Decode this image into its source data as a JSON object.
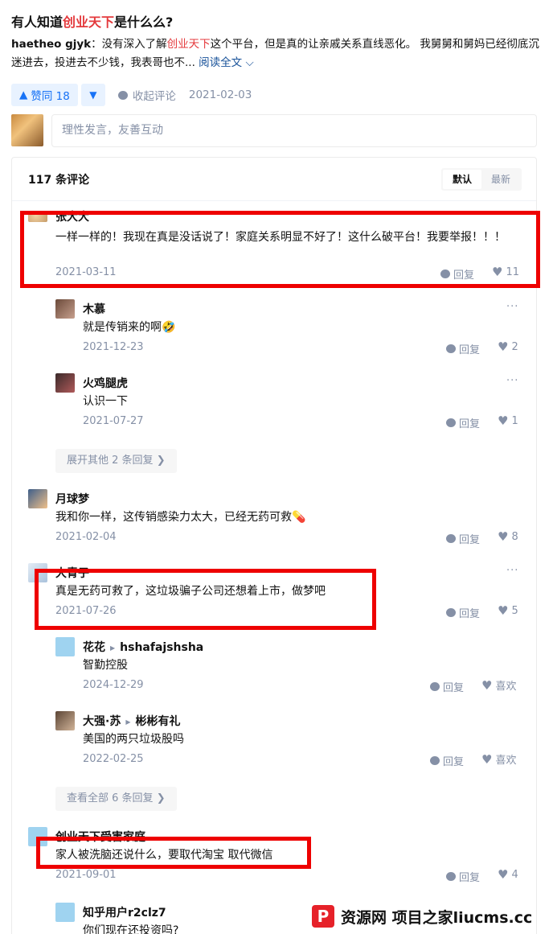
{
  "question": {
    "title_pre": "有人知道",
    "title_hl": "创业天下",
    "title_post": "是什么么?"
  },
  "answer": {
    "author": "haetheo gjyk",
    "sep": "：",
    "text_pre": "没有深入了解",
    "text_hl": "创业天下",
    "text_post": "这个平台，但是真的让亲戚关系直线恶化。 我舅舅和舅妈已经彻底沉迷进去，投进去不少钱，我表哥也不...",
    "read_more": "阅读全文",
    "read_more_icon": "chevron-down-icon"
  },
  "actions": {
    "upvote_label": "赞同 18",
    "upvote_icon": "triangle-up-icon",
    "downvote_icon": "triangle-down-icon",
    "collapse_comments": "收起评论",
    "date": "2021-02-03"
  },
  "comment_input": {
    "placeholder": "理性发言，友善互动"
  },
  "comments_panel": {
    "count_label": "117 条评论",
    "sort_default": "默认",
    "sort_latest": "最新"
  },
  "comments": [
    {
      "name": "张大大",
      "content": "一样一样的！我现在真是没话说了！家庭关系明显不好了！这什么破平台！我要举报！！！",
      "date": "2021-03-11",
      "reply": "回复",
      "likes": "11"
    },
    {
      "name": "木慕",
      "content": "就是传销来的啊🤣",
      "date": "2021-12-23",
      "reply": "回复",
      "likes": "2"
    },
    {
      "name": "火鸡腿虎",
      "content": "认识一下",
      "date": "2021-07-27",
      "reply": "回复",
      "likes": "1"
    },
    {
      "expand": "展开其他 2 条回复"
    },
    {
      "name": "月球梦",
      "content": "我和你一样，这传销感染力太大，已经无药可救💊",
      "date": "2021-02-04",
      "reply": "回复",
      "likes": "8"
    },
    {
      "name": "大青子",
      "content": "真是无药可救了，这垃圾骗子公司还想着上市，做梦吧",
      "date": "2021-07-26",
      "reply": "回复",
      "likes": "5"
    },
    {
      "name": "花花",
      "reply_to": "hshafajshsha",
      "content": "智勤控股",
      "date": "2024-12-29",
      "reply": "回复",
      "likes": "喜欢"
    },
    {
      "name": "大强·苏",
      "reply_to": "彬彬有礼",
      "content": "美国的两只垃圾股吗",
      "date": "2022-02-25",
      "reply": "回复",
      "likes": "喜欢"
    },
    {
      "expand": "查看全部 6 条回复"
    },
    {
      "name": "创业天下受害家庭",
      "content": "家人被洗脑还说什么，要取代淘宝 取代微信",
      "date": "2021-09-01",
      "reply": "回复",
      "likes": "4"
    },
    {
      "name": "知乎用户r2clz7",
      "content": "你们现在还投资吗?"
    }
  ],
  "more_dots": "···",
  "watermark": {
    "logo": "P",
    "text": "资源网 项目之家liucms.cc"
  }
}
